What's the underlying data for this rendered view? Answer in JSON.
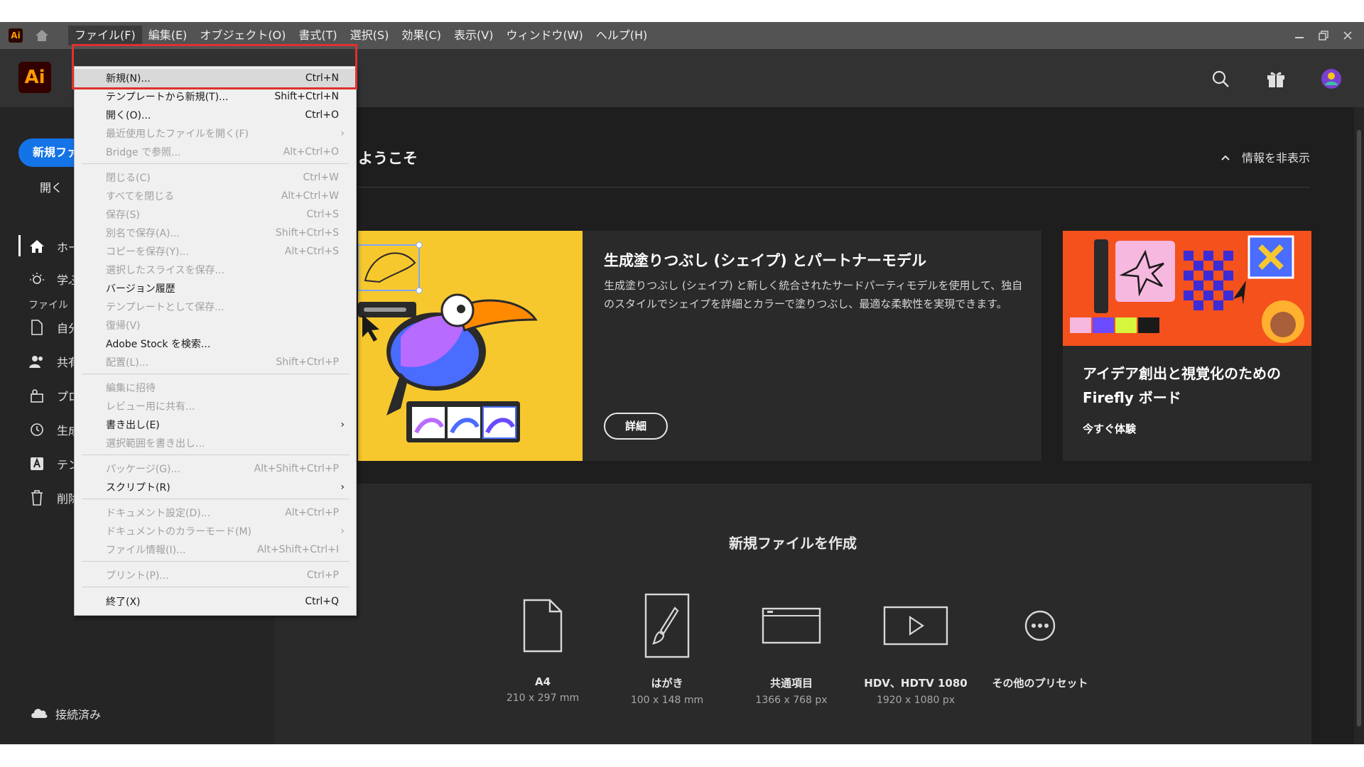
{
  "menubar": {
    "app_icon": "ai-mini-icon",
    "items": [
      "ファイル(F)",
      "編集(E)",
      "オブジェクト(O)",
      "書式(T)",
      "選択(S)",
      "効果(C)",
      "表示(V)",
      "ウィンドウ(W)",
      "ヘルプ(H)"
    ]
  },
  "header": {
    "logo": "Ai"
  },
  "sidebar": {
    "new_file": "新規ファイル",
    "open": "開く",
    "nav": [
      "ホーム",
      "学ぶ"
    ],
    "section_label": "ファイル",
    "files": [
      "自分のファイル",
      "共有ファイル",
      "プロジェクト",
      "生成履歴",
      "テンプレート",
      "削除済み"
    ],
    "cloud_status": "接続済み"
  },
  "main": {
    "welcome": "ようこそ",
    "hide_info": "情報を非表示",
    "feature": {
      "title": "生成塗りつぶし (シェイプ) とパートナーモデル",
      "description": "生成塗りつぶし (シェイプ) と新しく統合されたサードパーティモデルを使用して、独自のスタイルでシェイプを詳細とカラーで塗りつぶし、最適な柔軟性を実現できます。",
      "button": "詳細"
    },
    "side_card": {
      "title": "アイデア創出と視覚化のための Firefly ボード",
      "link": "今すぐ体験"
    },
    "create": {
      "title": "新規ファイルを作成",
      "presets": [
        {
          "name": "A4",
          "size": "210 x 297 mm"
        },
        {
          "name": "はがき",
          "size": "100 x 148 mm"
        },
        {
          "name": "共通項目",
          "size": "1366 x 768 px"
        },
        {
          "name": "HDV、HDTV 1080",
          "size": "1920 x 1080 px"
        },
        {
          "name": "その他のプリセット",
          "size": ""
        }
      ]
    }
  },
  "file_menu": {
    "items": [
      {
        "label": "新規(N)...",
        "shortcut": "Ctrl+N"
      },
      {
        "label": "テンプレートから新規(T)...",
        "shortcut": "Shift+Ctrl+N"
      },
      {
        "label": "開く(O)...",
        "shortcut": "Ctrl+O"
      },
      {
        "label": "最近使用したファイルを開く(F)",
        "shortcut": ""
      },
      {
        "label": "Bridge で参照...",
        "shortcut": "Alt+Ctrl+O"
      },
      {
        "label": "閉じる(C)",
        "shortcut": "Ctrl+W"
      },
      {
        "label": "すべてを閉じる",
        "shortcut": "Alt+Ctrl+W"
      },
      {
        "label": "保存(S)",
        "shortcut": "Ctrl+S"
      },
      {
        "label": "別名で保存(A)...",
        "shortcut": "Shift+Ctrl+S"
      },
      {
        "label": "コピーを保存(Y)...",
        "shortcut": "Alt+Ctrl+S"
      },
      {
        "label": "選択したスライスを保存...",
        "shortcut": ""
      },
      {
        "label": "バージョン履歴",
        "shortcut": ""
      },
      {
        "label": "テンプレートとして保存...",
        "shortcut": ""
      },
      {
        "label": "復帰(V)",
        "shortcut": ""
      },
      {
        "label": "Adobe Stock を検索...",
        "shortcut": ""
      },
      {
        "label": "配置(L)...",
        "shortcut": "Shift+Ctrl+P"
      },
      {
        "label": "編集に招待",
        "shortcut": ""
      },
      {
        "label": "レビュー用に共有...",
        "shortcut": ""
      },
      {
        "label": "書き出し(E)",
        "shortcut": ""
      },
      {
        "label": "選択範囲を書き出し...",
        "shortcut": ""
      },
      {
        "label": "パッケージ(G)...",
        "shortcut": "Alt+Shift+Ctrl+P"
      },
      {
        "label": "スクリプト(R)",
        "shortcut": ""
      },
      {
        "label": "ドキュメント設定(D)...",
        "shortcut": "Alt+Ctrl+P"
      },
      {
        "label": "ドキュメントのカラーモード(M)",
        "shortcut": ""
      },
      {
        "label": "ファイル情報(I)...",
        "shortcut": "Alt+Shift+Ctrl+I"
      },
      {
        "label": "プリント(P)...",
        "shortcut": "Ctrl+P"
      },
      {
        "label": "終了(X)",
        "shortcut": "Ctrl+Q"
      }
    ]
  },
  "colors": {
    "accent": "#1473e6",
    "highlight": "#e03030",
    "logo_bg": "#330000",
    "logo_fg": "#ff9a00"
  }
}
